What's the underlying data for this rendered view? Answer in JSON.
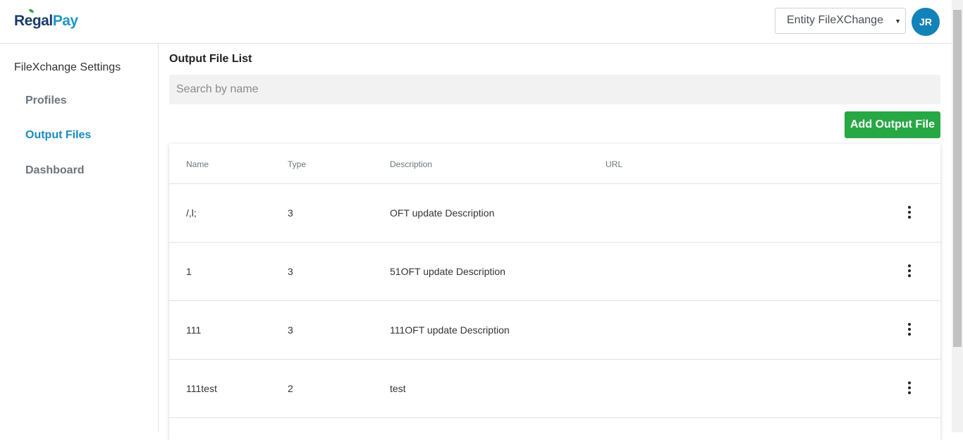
{
  "header": {
    "logo_part1": "Regal",
    "logo_part2": "Pay",
    "entity_select": "Entity FileXChange",
    "avatar_initials": "JR",
    "colors": {
      "brand_blue": "#1282b8",
      "accent_green": "#28a745"
    }
  },
  "sidebar": {
    "title": "FileXchange Settings",
    "items": [
      {
        "label": "Profiles",
        "active": false
      },
      {
        "label": "Output Files",
        "active": true
      },
      {
        "label": "Dashboard",
        "active": false
      }
    ]
  },
  "main": {
    "title": "Output File List",
    "search_placeholder": "Search by name",
    "add_button": "Add Output File",
    "table": {
      "columns": [
        "Name",
        "Type",
        "Description",
        "URL"
      ],
      "rows": [
        {
          "name": "/,l;",
          "type": "3",
          "description": "OFT update Description",
          "url": ""
        },
        {
          "name": "1",
          "type": "3",
          "description": "51OFT update Description",
          "url": ""
        },
        {
          "name": "111",
          "type": "3",
          "description": "111OFT update Description",
          "url": ""
        },
        {
          "name": "111test",
          "type": "2",
          "description": "test",
          "url": ""
        }
      ]
    }
  }
}
